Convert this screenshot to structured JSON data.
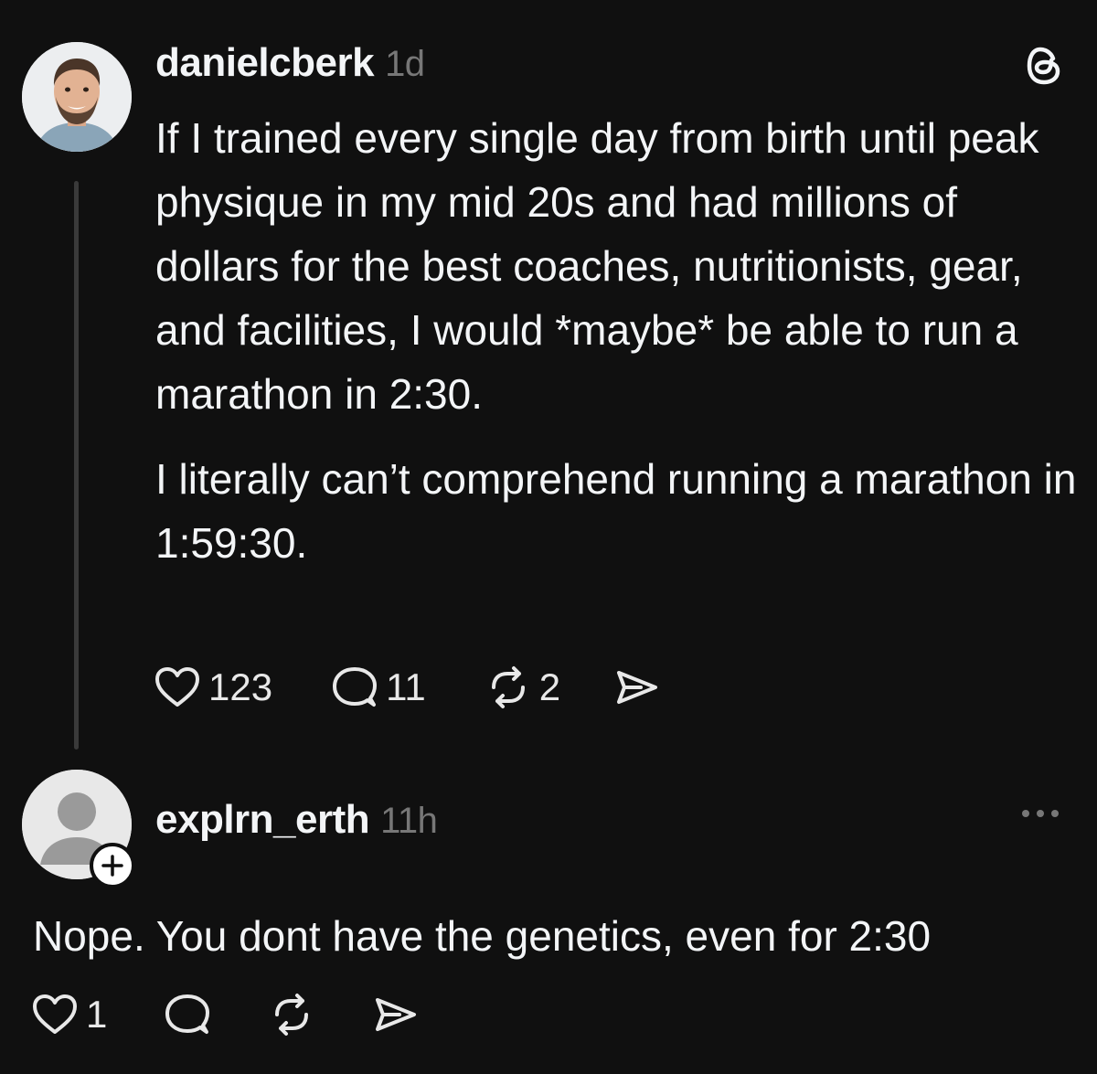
{
  "post": {
    "username": "danielcberk",
    "timestamp": "1d",
    "avatar_icon": "profile-photo",
    "paragraphs": [
      "If I trained every single day from birth until peak physique in my mid 20s and had millions of dollars for the best coaches, nutritionists, gear, and facilities, I would *maybe* be able to run a marathon in 2:30.",
      "I literally can’t comprehend running a marathon in 1:59:30."
    ],
    "likes": "123",
    "replies": "11",
    "reposts": "2"
  },
  "reply": {
    "username": "explrn_erth",
    "timestamp": "11h",
    "avatar_icon": "default-avatar-icon",
    "text": "Nope. You dont have the genetics, even for 2:30",
    "likes": "1"
  },
  "icons": {
    "brand": "threads-logo-icon",
    "more": "more-dots-icon",
    "like": "heart-icon",
    "reply": "comment-icon",
    "repost": "repost-icon",
    "share": "share-icon",
    "follow": "plus-icon"
  },
  "colors": {
    "background": "#101010",
    "text": "#f3f5f7",
    "muted": "#777777",
    "thread_line": "#3a3a3a"
  }
}
